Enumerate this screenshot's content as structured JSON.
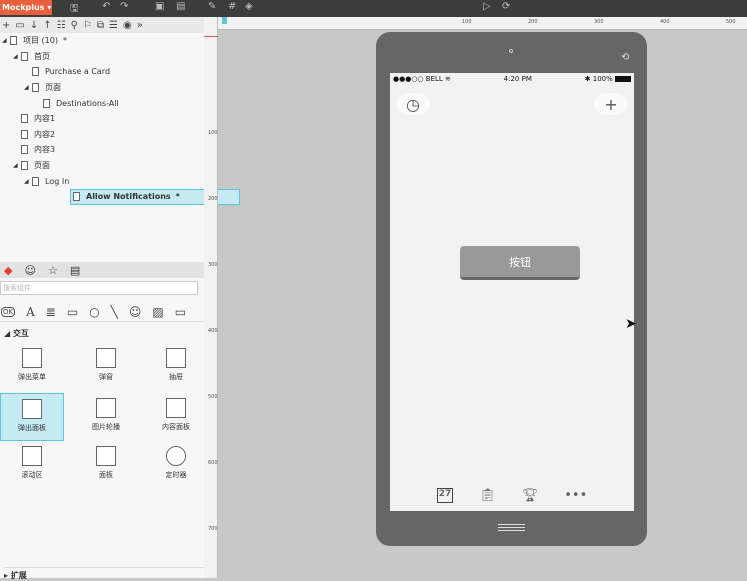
{
  "app": {
    "name": "Mockplus"
  },
  "tree": [
    {
      "label": "项目 (10)",
      "level": 0,
      "expand": true,
      "mark": "*"
    },
    {
      "label": "首页",
      "level": 1,
      "expand": true
    },
    {
      "label": "Purchase a Card",
      "level": 2
    },
    {
      "label": "页面",
      "level": 2,
      "expand": true
    },
    {
      "label": "Destinations-All",
      "level": 3
    },
    {
      "label": "内容1",
      "level": 1
    },
    {
      "label": "内容2",
      "level": 1
    },
    {
      "label": "内容3",
      "level": 1
    },
    {
      "label": "页面",
      "level": 1,
      "expand": true
    },
    {
      "label": "Log In",
      "level": 2,
      "expand": true
    },
    {
      "label": "Allow Notifications",
      "level": 3,
      "selected": true,
      "mark": "*"
    }
  ],
  "components": {
    "search_placeholder": "搜索组件",
    "section": "交互",
    "footer_section": "扩展",
    "items": [
      "弹出菜单",
      "弹窗",
      "抽屉",
      "弹出面板",
      "图片轮播",
      "内容面板",
      "滚动区",
      "面板",
      "定时器"
    ]
  },
  "ruler": {
    "top": [
      "100",
      "200",
      "300",
      "400",
      "500"
    ],
    "left": [
      "100",
      "200",
      "300",
      "400",
      "500",
      "600",
      "700"
    ]
  },
  "phone": {
    "carrier": "●●●○○ BELL",
    "time": "4:20 PM",
    "battery": "100%",
    "button": "按钮",
    "calendar_day": "27",
    "tabs": [
      "calendar-icon",
      "clipboard-icon",
      "trophy-icon",
      "more-icon"
    ]
  }
}
